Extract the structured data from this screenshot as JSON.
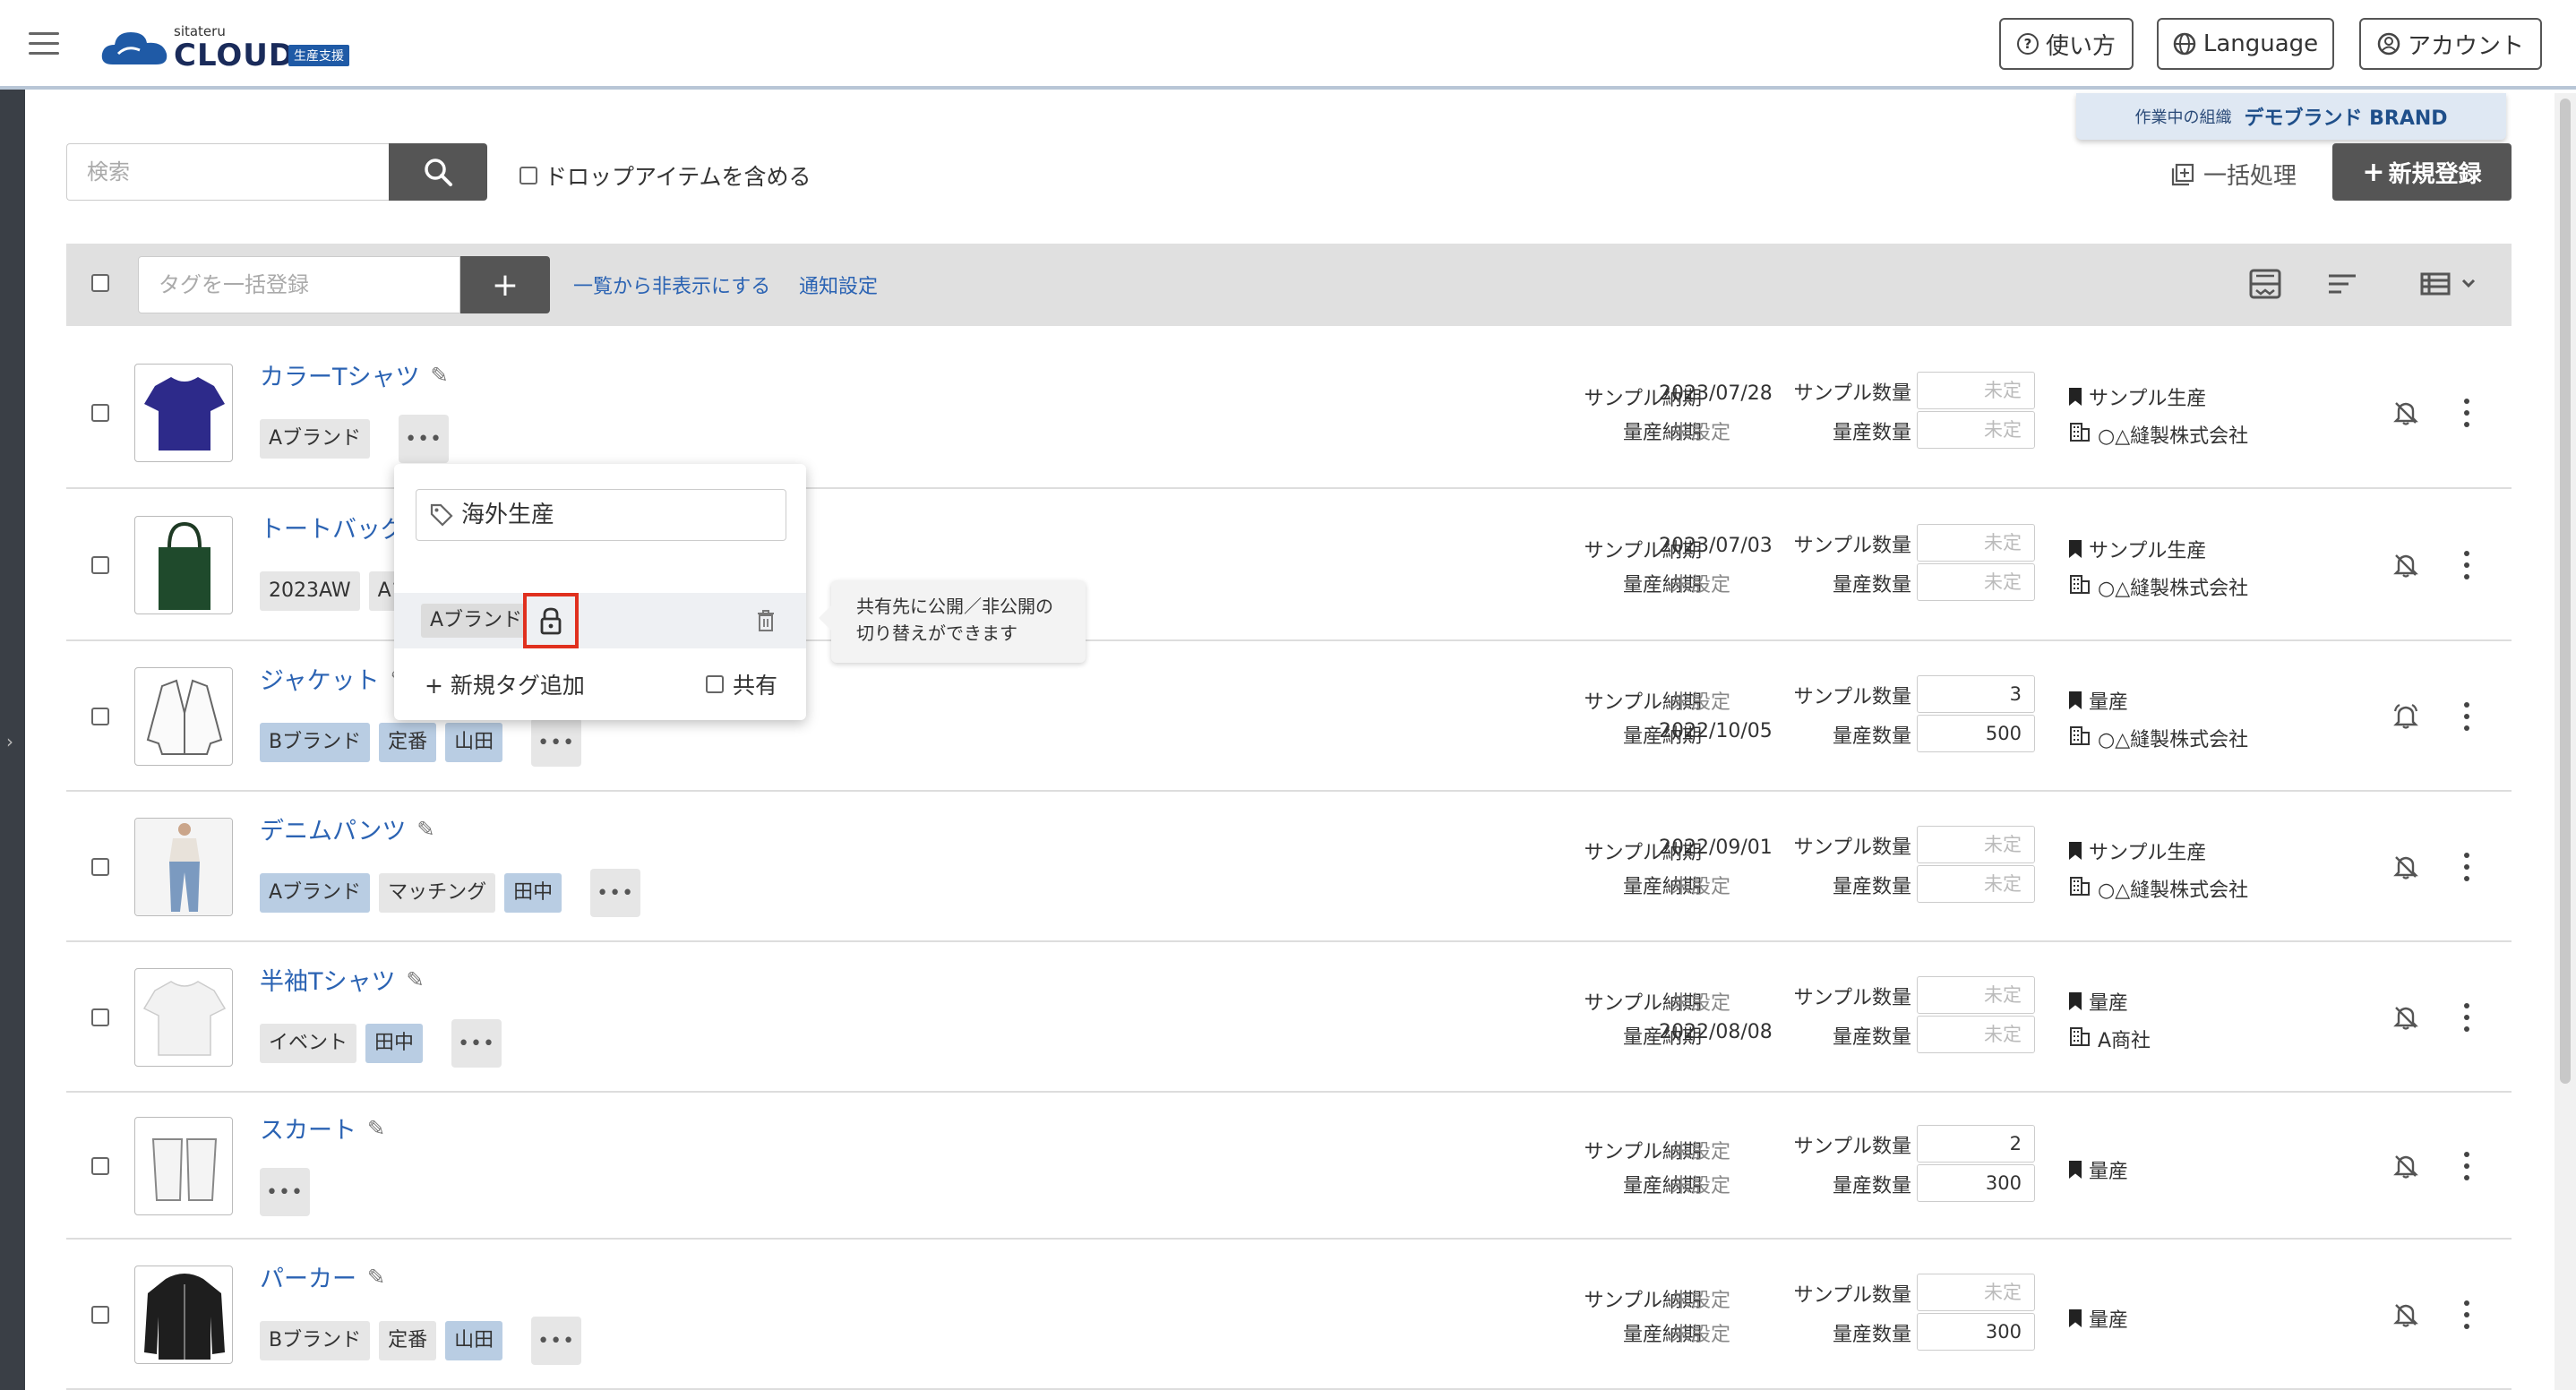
{
  "header": {
    "logo_sub": "sitateru",
    "logo_main": "CLOUD",
    "logo_badge": "生産支援",
    "help_label": "使い方",
    "language_label": "Language",
    "account_label": "アカウント"
  },
  "org": {
    "label": "作業中の組織",
    "name": "デモブランド BRAND"
  },
  "search": {
    "placeholder": "検索",
    "include_drop_label": "ドロップアイテムを含める"
  },
  "actions": {
    "bulk_label": "一括処理",
    "new_label": "新規登録"
  },
  "toolbar": {
    "tag_placeholder": "タグを一括登録",
    "add_symbol": "+",
    "hide_link": "一覧から非表示にする",
    "notify_link": "通知設定"
  },
  "labels": {
    "sample_due": "サンプル納期",
    "mass_due": "量産納期",
    "sample_qty": "サンプル数量",
    "mass_qty": "量産数量",
    "undecided": "未定"
  },
  "items": [
    {
      "name": "カラーTシャツ",
      "tags": [
        {
          "label": "Aブランド",
          "shared": false
        }
      ],
      "sample_due": "2023/07/28",
      "mass_due": "未設定",
      "sample_qty": "未定",
      "mass_qty": "未定",
      "status": "サンプル生産",
      "factory": "○△縫製株式会社",
      "bell": "off"
    },
    {
      "name": "トートバッグ",
      "tags": [
        {
          "label": "2023AW",
          "shared": false
        },
        {
          "label": "Aブ",
          "shared": false
        }
      ],
      "sample_due": "2023/07/03",
      "mass_due": "未設定",
      "sample_qty": "未定",
      "mass_qty": "未定",
      "status": "サンプル生産",
      "factory": "○△縫製株式会社",
      "bell": "off"
    },
    {
      "name": "ジャケット",
      "tags": [
        {
          "label": "Bブランド",
          "shared": true
        },
        {
          "label": "定番",
          "shared": true
        },
        {
          "label": "山田",
          "shared": true
        }
      ],
      "sample_due": "未設定",
      "mass_due": "2022/10/05",
      "sample_qty": "3",
      "mass_qty": "500",
      "status": "量産",
      "factory": "○△縫製株式会社",
      "bell": "on"
    },
    {
      "name": "デニムパンツ",
      "tags": [
        {
          "label": "Aブランド",
          "shared": true
        },
        {
          "label": "マッチング",
          "shared": false
        },
        {
          "label": "田中",
          "shared": true
        }
      ],
      "sample_due": "2022/09/01",
      "mass_due": "未設定",
      "sample_qty": "未定",
      "mass_qty": "未定",
      "status": "サンプル生産",
      "factory": "○△縫製株式会社",
      "bell": "off"
    },
    {
      "name": "半袖Tシャツ",
      "tags": [
        {
          "label": "イベント",
          "shared": false
        },
        {
          "label": "田中",
          "shared": true
        }
      ],
      "sample_due": "未設定",
      "mass_due": "2022/08/08",
      "sample_qty": "未定",
      "mass_qty": "未定",
      "status": "量産",
      "factory": "A商社",
      "bell": "off"
    },
    {
      "name": "スカート",
      "tags": [],
      "sample_due": "未設定",
      "mass_due": "未設定",
      "sample_qty": "2",
      "mass_qty": "300",
      "status": "量産",
      "factory": "",
      "bell": "off"
    },
    {
      "name": "パーカー",
      "tags": [
        {
          "label": "Bブランド",
          "shared": false
        },
        {
          "label": "定番",
          "shared": false
        },
        {
          "label": "山田",
          "shared": true
        }
      ],
      "sample_due": "未設定",
      "mass_due": "未設定",
      "sample_qty": "未定",
      "mass_qty": "300",
      "status": "量産",
      "factory": "",
      "bell": "off"
    }
  ],
  "popup": {
    "tag_input_value": "海外生産",
    "selected_tag": "Aブランド",
    "add_tag_label": "新規タグ追加",
    "share_label": "共有",
    "tooltip": "共有先に公開／非公開の切り替えができます"
  },
  "colors": {
    "accent": "#2b63b3",
    "highlight": "#e0301e",
    "tag_shared": "#b9cde3",
    "dark_button": "#555555"
  }
}
